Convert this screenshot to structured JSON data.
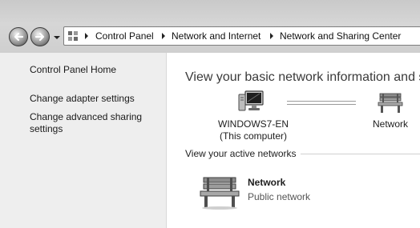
{
  "address_bar": {
    "breadcrumbs": [
      "Control Panel",
      "Network and Internet",
      "Network and Sharing Center"
    ]
  },
  "left_pane": {
    "links": [
      "Control Panel Home",
      "Change adapter settings",
      "Change advanced sharing",
      "settings"
    ]
  },
  "main": {
    "title": "View your basic network information and s",
    "network_map": {
      "computer_name": "WINDOWS7-EN",
      "computer_note": "(This computer)",
      "network_label": "Network"
    },
    "active_networks": {
      "heading": "View your active networks",
      "items": [
        {
          "name": "Network",
          "type": "Public network"
        }
      ]
    }
  },
  "icons": {
    "back": "back-arrow-icon",
    "forward": "forward-arrow-icon",
    "recent": "chevron-down-icon",
    "location": "control-panel-icon",
    "computer": "computer-icon",
    "network": "bench-icon"
  }
}
